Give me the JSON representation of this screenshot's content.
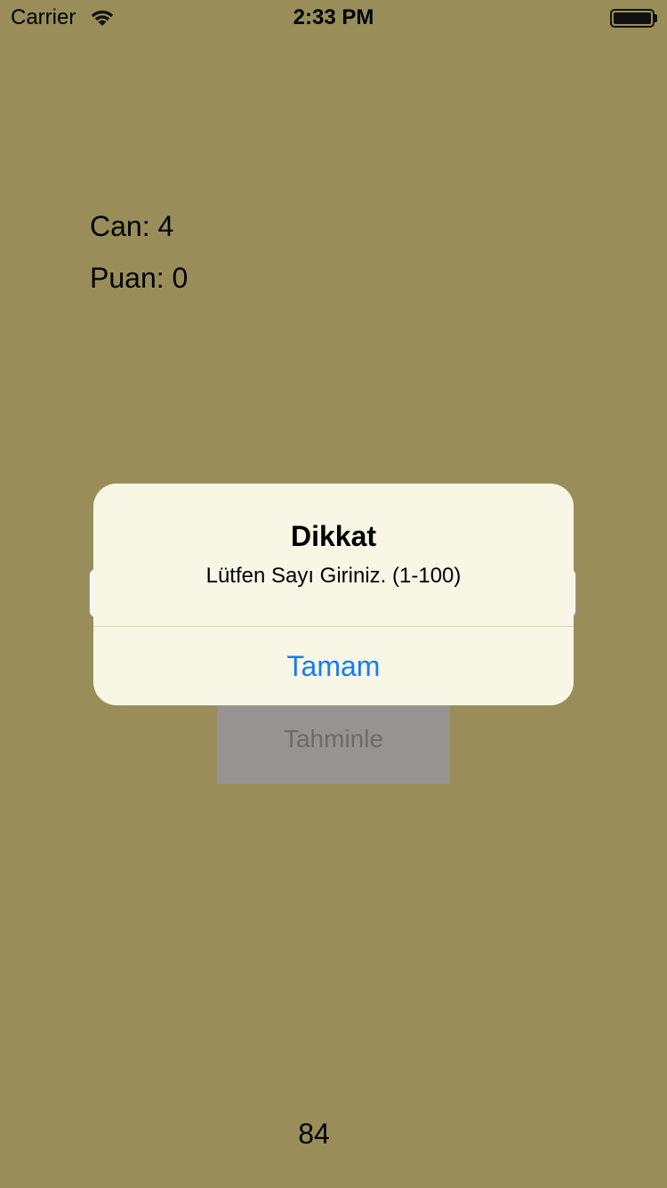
{
  "status_bar": {
    "carrier": "Carrier",
    "time": "2:33 PM",
    "wifi_icon": "wifi-icon",
    "battery_icon": "battery-icon",
    "battery_level": 1.0
  },
  "stats": {
    "lives_label": "Can: 4",
    "score_label": "Puan: 0"
  },
  "guess": {
    "input_value": "",
    "button_label": "Tahminle"
  },
  "target_number": "84",
  "alert": {
    "title": "Dikkat",
    "message": "Lütfen Sayı Giriniz. (1-100)",
    "button_label": "Tamam"
  },
  "colors": {
    "background": "#998e5a",
    "alert_background": "#f8f7e5",
    "action_blue": "#157cf7"
  }
}
